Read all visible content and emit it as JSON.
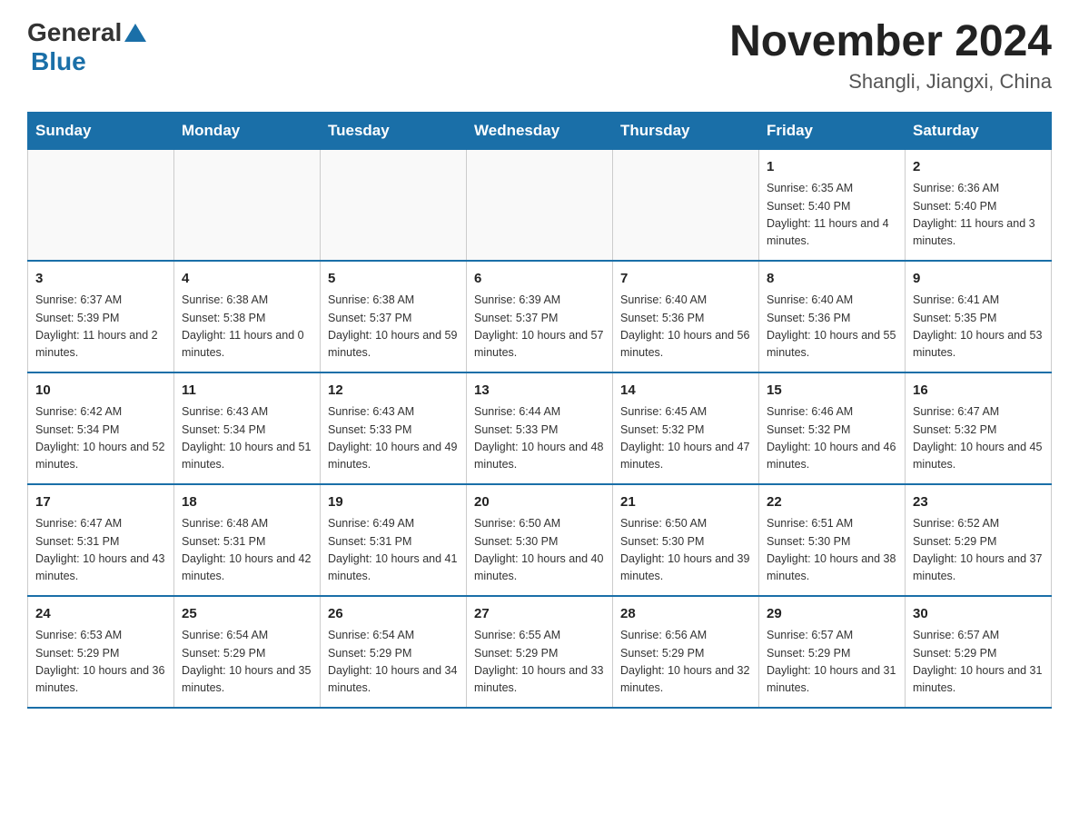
{
  "logo": {
    "general": "General",
    "blue": "Blue"
  },
  "header": {
    "month_year": "November 2024",
    "location": "Shangli, Jiangxi, China"
  },
  "weekdays": [
    "Sunday",
    "Monday",
    "Tuesday",
    "Wednesday",
    "Thursday",
    "Friday",
    "Saturday"
  ],
  "weeks": [
    [
      {
        "day": "",
        "info": ""
      },
      {
        "day": "",
        "info": ""
      },
      {
        "day": "",
        "info": ""
      },
      {
        "day": "",
        "info": ""
      },
      {
        "day": "",
        "info": ""
      },
      {
        "day": "1",
        "info": "Sunrise: 6:35 AM\nSunset: 5:40 PM\nDaylight: 11 hours and 4 minutes."
      },
      {
        "day": "2",
        "info": "Sunrise: 6:36 AM\nSunset: 5:40 PM\nDaylight: 11 hours and 3 minutes."
      }
    ],
    [
      {
        "day": "3",
        "info": "Sunrise: 6:37 AM\nSunset: 5:39 PM\nDaylight: 11 hours and 2 minutes."
      },
      {
        "day": "4",
        "info": "Sunrise: 6:38 AM\nSunset: 5:38 PM\nDaylight: 11 hours and 0 minutes."
      },
      {
        "day": "5",
        "info": "Sunrise: 6:38 AM\nSunset: 5:37 PM\nDaylight: 10 hours and 59 minutes."
      },
      {
        "day": "6",
        "info": "Sunrise: 6:39 AM\nSunset: 5:37 PM\nDaylight: 10 hours and 57 minutes."
      },
      {
        "day": "7",
        "info": "Sunrise: 6:40 AM\nSunset: 5:36 PM\nDaylight: 10 hours and 56 minutes."
      },
      {
        "day": "8",
        "info": "Sunrise: 6:40 AM\nSunset: 5:36 PM\nDaylight: 10 hours and 55 minutes."
      },
      {
        "day": "9",
        "info": "Sunrise: 6:41 AM\nSunset: 5:35 PM\nDaylight: 10 hours and 53 minutes."
      }
    ],
    [
      {
        "day": "10",
        "info": "Sunrise: 6:42 AM\nSunset: 5:34 PM\nDaylight: 10 hours and 52 minutes."
      },
      {
        "day": "11",
        "info": "Sunrise: 6:43 AM\nSunset: 5:34 PM\nDaylight: 10 hours and 51 minutes."
      },
      {
        "day": "12",
        "info": "Sunrise: 6:43 AM\nSunset: 5:33 PM\nDaylight: 10 hours and 49 minutes."
      },
      {
        "day": "13",
        "info": "Sunrise: 6:44 AM\nSunset: 5:33 PM\nDaylight: 10 hours and 48 minutes."
      },
      {
        "day": "14",
        "info": "Sunrise: 6:45 AM\nSunset: 5:32 PM\nDaylight: 10 hours and 47 minutes."
      },
      {
        "day": "15",
        "info": "Sunrise: 6:46 AM\nSunset: 5:32 PM\nDaylight: 10 hours and 46 minutes."
      },
      {
        "day": "16",
        "info": "Sunrise: 6:47 AM\nSunset: 5:32 PM\nDaylight: 10 hours and 45 minutes."
      }
    ],
    [
      {
        "day": "17",
        "info": "Sunrise: 6:47 AM\nSunset: 5:31 PM\nDaylight: 10 hours and 43 minutes."
      },
      {
        "day": "18",
        "info": "Sunrise: 6:48 AM\nSunset: 5:31 PM\nDaylight: 10 hours and 42 minutes."
      },
      {
        "day": "19",
        "info": "Sunrise: 6:49 AM\nSunset: 5:31 PM\nDaylight: 10 hours and 41 minutes."
      },
      {
        "day": "20",
        "info": "Sunrise: 6:50 AM\nSunset: 5:30 PM\nDaylight: 10 hours and 40 minutes."
      },
      {
        "day": "21",
        "info": "Sunrise: 6:50 AM\nSunset: 5:30 PM\nDaylight: 10 hours and 39 minutes."
      },
      {
        "day": "22",
        "info": "Sunrise: 6:51 AM\nSunset: 5:30 PM\nDaylight: 10 hours and 38 minutes."
      },
      {
        "day": "23",
        "info": "Sunrise: 6:52 AM\nSunset: 5:29 PM\nDaylight: 10 hours and 37 minutes."
      }
    ],
    [
      {
        "day": "24",
        "info": "Sunrise: 6:53 AM\nSunset: 5:29 PM\nDaylight: 10 hours and 36 minutes."
      },
      {
        "day": "25",
        "info": "Sunrise: 6:54 AM\nSunset: 5:29 PM\nDaylight: 10 hours and 35 minutes."
      },
      {
        "day": "26",
        "info": "Sunrise: 6:54 AM\nSunset: 5:29 PM\nDaylight: 10 hours and 34 minutes."
      },
      {
        "day": "27",
        "info": "Sunrise: 6:55 AM\nSunset: 5:29 PM\nDaylight: 10 hours and 33 minutes."
      },
      {
        "day": "28",
        "info": "Sunrise: 6:56 AM\nSunset: 5:29 PM\nDaylight: 10 hours and 32 minutes."
      },
      {
        "day": "29",
        "info": "Sunrise: 6:57 AM\nSunset: 5:29 PM\nDaylight: 10 hours and 31 minutes."
      },
      {
        "day": "30",
        "info": "Sunrise: 6:57 AM\nSunset: 5:29 PM\nDaylight: 10 hours and 31 minutes."
      }
    ]
  ]
}
